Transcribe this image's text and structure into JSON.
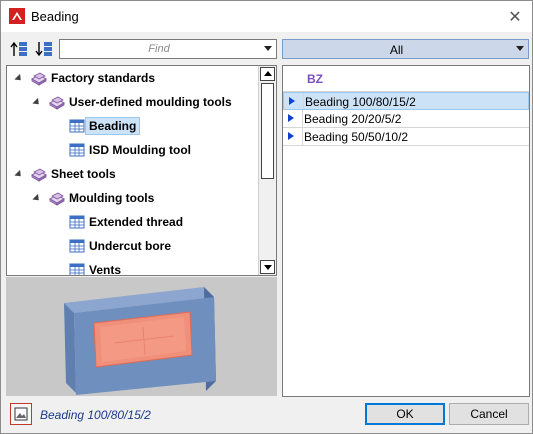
{
  "window": {
    "title": "Beading"
  },
  "toolbar": {
    "find_placeholder": "Find",
    "filter_value": "All"
  },
  "tree": {
    "items": [
      {
        "label": "Factory standards",
        "level": 0,
        "icon": "catalog-icon",
        "expanded": true
      },
      {
        "label": "User-defined moulding tools",
        "level": 1,
        "icon": "catalog-icon",
        "expanded": true
      },
      {
        "label": "Beading",
        "level": 2,
        "icon": "table-icon",
        "selected": true
      },
      {
        "label": "ISD Moulding tool",
        "level": 2,
        "icon": "table-icon"
      },
      {
        "label": "Sheet tools",
        "level": 0,
        "icon": "catalog-icon",
        "expanded": true
      },
      {
        "label": "Moulding tools",
        "level": 1,
        "icon": "catalog-icon",
        "expanded": true
      },
      {
        "label": "Extended thread",
        "level": 2,
        "icon": "table-icon"
      },
      {
        "label": "Undercut bore",
        "level": 2,
        "icon": "table-icon"
      },
      {
        "label": "Vents",
        "level": 2,
        "icon": "table-icon"
      }
    ]
  },
  "table": {
    "header": "BZ",
    "rows": [
      {
        "value": "Beading 100/80/15/2",
        "selected": true
      },
      {
        "value": "Beading 20/20/5/2"
      },
      {
        "value": "Beading 50/50/10/2"
      }
    ]
  },
  "footer": {
    "status": "Beading 100/80/15/2",
    "ok_label": "OK",
    "cancel_label": "Cancel"
  },
  "colors": {
    "accent": "#0078d7",
    "selection": "#cce3f7",
    "column_header": "#7b4fbf",
    "preview_face": "#f0907a",
    "preview_body": "#6f8fbf"
  }
}
